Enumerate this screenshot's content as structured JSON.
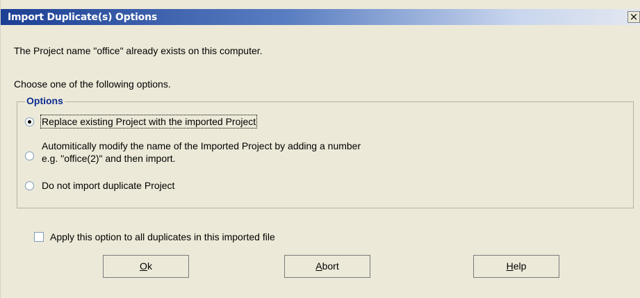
{
  "window": {
    "title": "Import Duplicate(s) Options",
    "close_glyph": "×",
    "close_icon": "close-icon"
  },
  "message": "The Project name \"office\" already exists on this computer.",
  "instruction": "Choose one of the following options.",
  "options_group": {
    "legend": "Options",
    "items": [
      {
        "label": "Replace existing Project with the imported Project",
        "selected": true
      },
      {
        "label_line1": "Automitically modify the name of the Imported Project by adding a number",
        "label_line2": "e.g. \"office(2)\" and then import.",
        "selected": false
      },
      {
        "label": "Do not import duplicate Project",
        "selected": false
      }
    ]
  },
  "apply_all": {
    "label": "Apply this option to all duplicates in this imported file",
    "checked": false
  },
  "buttons": {
    "ok": {
      "key": "O",
      "rest": "k"
    },
    "abort": {
      "key": "A",
      "rest": "bort"
    },
    "help": {
      "key": "H",
      "rest": "elp"
    }
  },
  "colors": {
    "title_bar_start": "#1c3f94",
    "legend_text": "#0d2d90",
    "dialog_bg": "#ece9d8"
  }
}
